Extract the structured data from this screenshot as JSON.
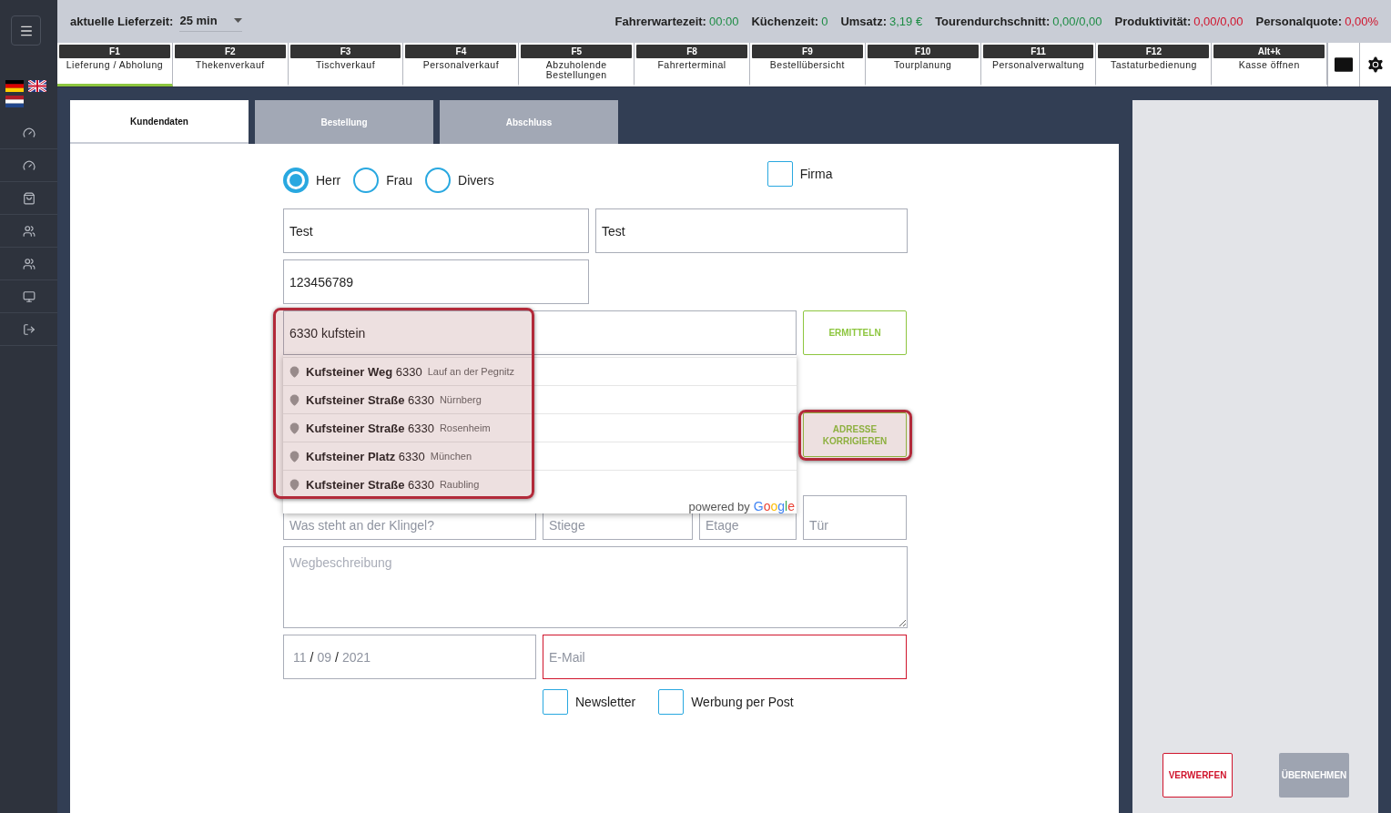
{
  "top_bar": {
    "delivery_time": {
      "label": "aktuelle Lieferzeit:",
      "value": "25 min"
    },
    "stats": [
      {
        "label": "Fahrerwartezeit:",
        "value": "00:00",
        "color": "#1e8c45"
      },
      {
        "label": "Küchenzeit:",
        "value": "0",
        "color": "#1e8c45"
      },
      {
        "label": "Umsatz:",
        "value": "3,19 €",
        "color": "#1e8c45"
      },
      {
        "label": "Tourendurchschnitt:",
        "value": "0,00/0,00",
        "color": "#1e8c45"
      },
      {
        "label": "Produktivität:",
        "value": "0,00/0,00",
        "color": "#d0142c"
      },
      {
        "label": "Personalquote:",
        "value": "0,00%",
        "color": "#d0142c"
      }
    ]
  },
  "function_keys": [
    {
      "key": "F1",
      "label": "Lieferung / Abholung",
      "selected": true
    },
    {
      "key": "F2",
      "label": "Thekenverkauf",
      "selected": false
    },
    {
      "key": "F3",
      "label": "Tischverkauf",
      "selected": false
    },
    {
      "key": "F4",
      "label": "Personalverkauf",
      "selected": false
    },
    {
      "key": "F5",
      "label": "Abzuholende Bestellungen",
      "selected": false
    },
    {
      "key": "F8",
      "label": "Fahrerterminal",
      "selected": false
    },
    {
      "key": "F9",
      "label": "Bestellübersicht",
      "selected": false
    },
    {
      "key": "F10",
      "label": "Tourplanung",
      "selected": false
    },
    {
      "key": "F11",
      "label": "Personalverwaltung",
      "selected": false
    },
    {
      "key": "F12",
      "label": "Tastaturbedienung",
      "selected": false
    },
    {
      "key": "Alt+k",
      "label": "Kasse öffnen",
      "selected": false
    }
  ],
  "tabs": [
    {
      "label": "Kundendaten",
      "selected": true
    },
    {
      "label": "Bestellung",
      "selected": false
    },
    {
      "label": "Abschluss",
      "selected": false
    }
  ],
  "form": {
    "salutation": [
      {
        "label": "Herr",
        "selected": true
      },
      {
        "label": "Frau",
        "selected": false
      },
      {
        "label": "Divers",
        "selected": false
      }
    ],
    "company": {
      "label": "Firma",
      "checked": false
    },
    "first_name": {
      "value": "Test"
    },
    "last_name": {
      "value": "Test"
    },
    "phone": {
      "value": "123456789"
    },
    "address": {
      "value": "6330 kufstein"
    },
    "determine_button": "ERMITTELN",
    "correct_button": "ADRESSE KORRIGIEREN",
    "suggestions": [
      {
        "main": "**Kufsteiner Weg** 6330",
        "city": "Lauf an der Pegnitz"
      },
      {
        "main": "**Kufsteiner Straße** 6330",
        "city": "Nürnberg"
      },
      {
        "main": "**Kufsteiner Straße** 6330",
        "city": "Rosenheim"
      },
      {
        "main": "**Kufsteiner Platz** 6330",
        "city": "München"
      },
      {
        "main": "**Kufsteiner Straße** 6330",
        "city": "Raubling"
      }
    ],
    "attribution": {
      "prefix": "powered by",
      "brand": "Google"
    },
    "bell": {
      "placeholder": "Was steht an der Klingel?"
    },
    "stair": {
      "placeholder": "Stiege"
    },
    "floor": {
      "placeholder": "Etage"
    },
    "door": {
      "placeholder": "Tür"
    },
    "directions": {
      "placeholder": "Wegbeschreibung"
    },
    "date": [
      {
        "kind": "value",
        "text": "11"
      },
      {
        "kind": "separator",
        "text": "/"
      },
      {
        "kind": "value",
        "text": "09"
      },
      {
        "kind": "separator",
        "text": "/"
      },
      {
        "kind": "value",
        "text": "2021"
      }
    ],
    "email": {
      "placeholder": "E-Mail",
      "invalid": true
    },
    "options": [
      {
        "label": "Newsletter",
        "checked": false
      },
      {
        "label": "Werbung per Post",
        "checked": false
      }
    ]
  },
  "actions": [
    {
      "label": "VERWERFEN",
      "kind": "discard",
      "disabled": false
    },
    {
      "label": "ÜBERNEHMEN",
      "kind": "apply",
      "disabled": true
    }
  ]
}
